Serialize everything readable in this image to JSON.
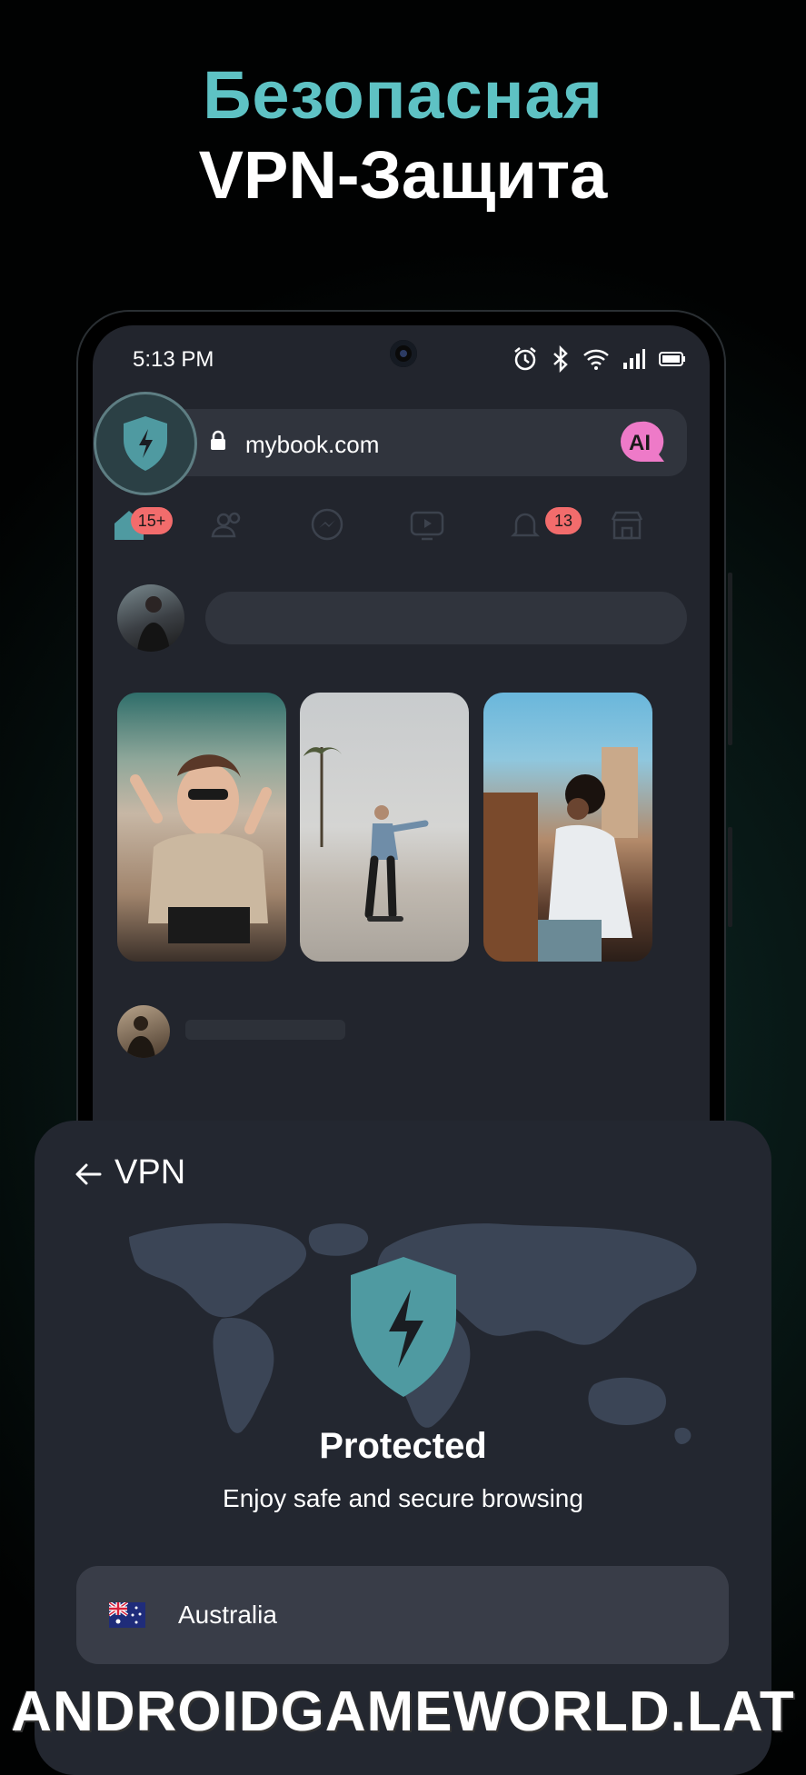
{
  "promo": {
    "headline_line1": "Безопасная",
    "headline_line2": "VPN-Защита"
  },
  "status_bar": {
    "time": "5:13 PM",
    "icons": [
      "alarm-icon",
      "bluetooth-icon",
      "wifi-icon",
      "signal-icon",
      "battery-icon"
    ]
  },
  "browser": {
    "url": "mybook.com",
    "ai_label": "AI"
  },
  "nav": {
    "items": [
      {
        "icon": "home-icon",
        "badge": "15+"
      },
      {
        "icon": "friends-icon",
        "badge": ""
      },
      {
        "icon": "messenger-icon",
        "badge": ""
      },
      {
        "icon": "video-icon",
        "badge": ""
      },
      {
        "icon": "bell-icon",
        "badge": "13"
      },
      {
        "icon": "marketplace-icon",
        "badge": ""
      }
    ]
  },
  "vpn_panel": {
    "title": "VPN",
    "status": "Protected",
    "tagline": "Enjoy safe and secure browsing",
    "country": "Australia"
  },
  "watermark": "ANDROIDGAMEWORLD.LAT",
  "colors": {
    "accent_teal": "#5ec2c4",
    "shield_teal": "#4f9aa1",
    "badge_red": "#f26c6c",
    "ai_pink": "#ee7ac8",
    "card_bg": "#232730"
  }
}
